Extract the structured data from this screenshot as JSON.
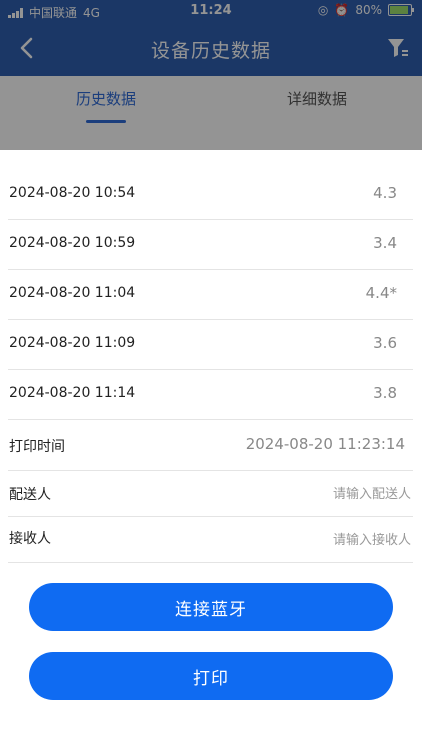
{
  "status_bar": {
    "carrier": "中国联通",
    "network": "4G",
    "time": "11:24",
    "battery": "80%"
  },
  "nav": {
    "title": "设备历史数据"
  },
  "tabs": [
    {
      "label": "历史数据",
      "active": true
    },
    {
      "label": "详细数据",
      "active": false
    }
  ],
  "records": [
    {
      "date": "2024-08-20 10:54",
      "value": "4.3"
    },
    {
      "date": "2024-08-20 10:59",
      "value": "3.4"
    },
    {
      "date": "2024-08-20 11:04",
      "value": "4.4*"
    },
    {
      "date": "2024-08-20 11:09",
      "value": "3.6"
    },
    {
      "date": "2024-08-20 11:14",
      "value": "3.8"
    }
  ],
  "print_time": {
    "label": "打印时间",
    "value": "2024-08-20 11:23:14"
  },
  "sender": {
    "label": "配送人",
    "placeholder": "请输入配送人"
  },
  "receiver": {
    "label": "接收人",
    "placeholder": "请输入接收人"
  },
  "buttons": {
    "connect_bluetooth": "连接蓝牙",
    "print": "打印"
  },
  "colors": {
    "nav_bg": "#2f5fb0",
    "accent": "#2f6bd8",
    "button": "#0f6bf2"
  }
}
